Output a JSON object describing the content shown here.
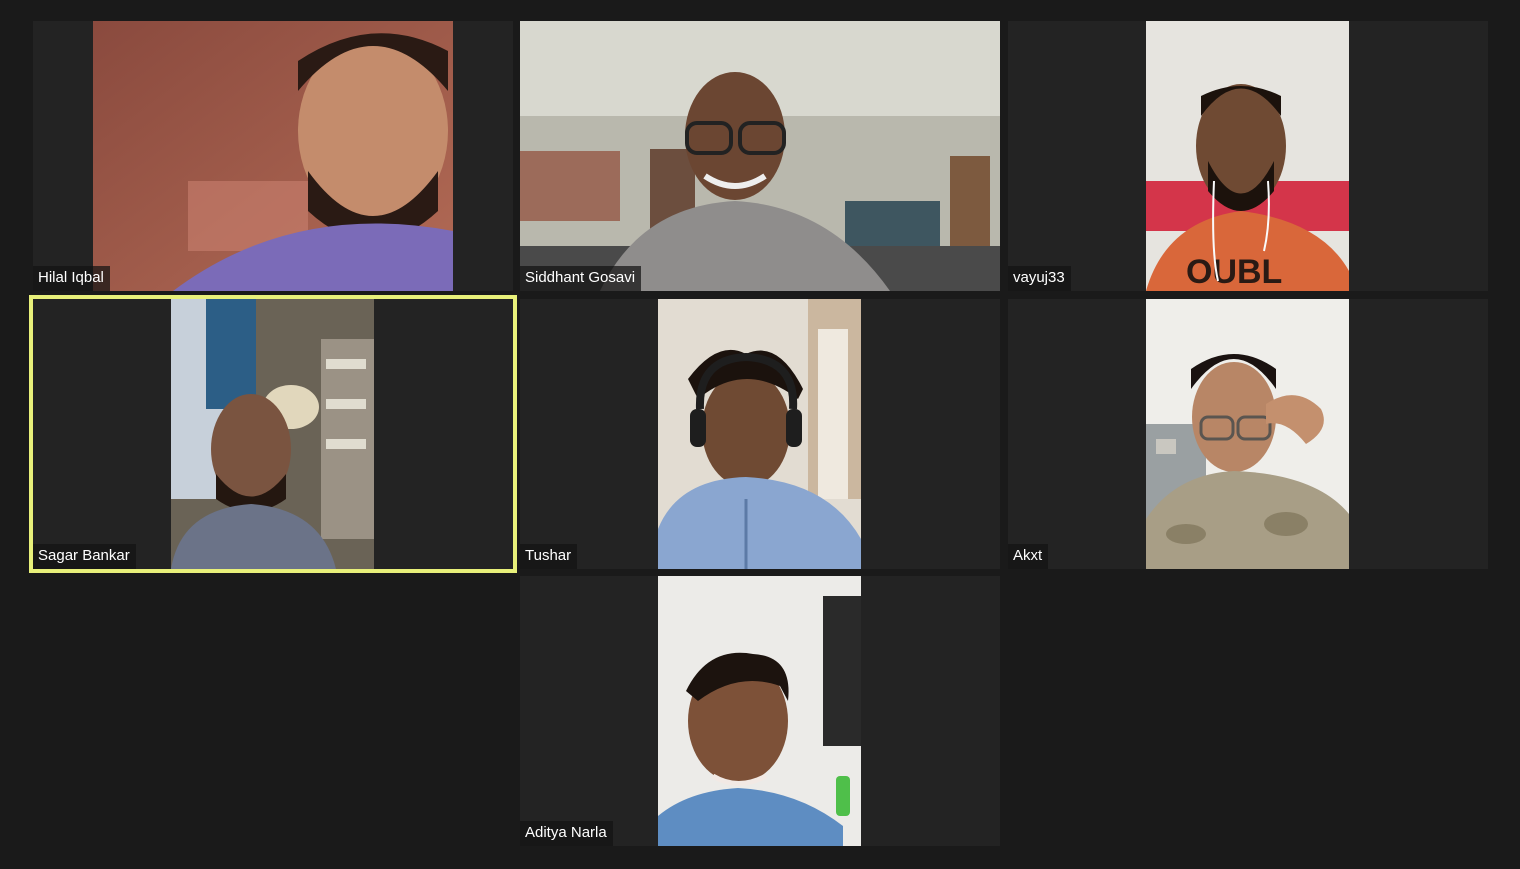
{
  "meeting": {
    "layout": "gallery-view",
    "active_speaker_color": "#e8f07a"
  },
  "participants": [
    {
      "name": "Hilal Iqbal",
      "speaking": false,
      "video": "on"
    },
    {
      "name": "Siddhant Gosavi",
      "speaking": false,
      "video": "on"
    },
    {
      "name": "vayuj33",
      "speaking": false,
      "video": "on"
    },
    {
      "name": "Sagar Bankar",
      "speaking": true,
      "video": "on"
    },
    {
      "name": "Tushar",
      "speaking": false,
      "video": "on"
    },
    {
      "name": "Akxt",
      "speaking": false,
      "video": "on"
    },
    {
      "name": "Aditya Narla",
      "speaking": false,
      "video": "on"
    }
  ]
}
